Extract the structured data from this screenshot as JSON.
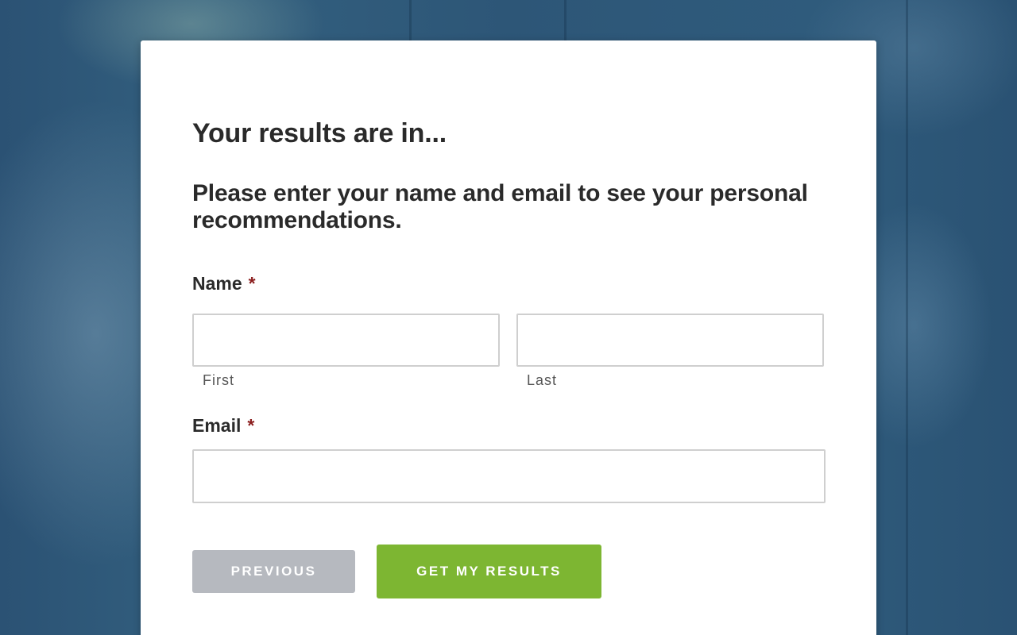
{
  "form": {
    "heading": "Your results are in...",
    "subheading": "Please enter your name and email to see your personal recommendations.",
    "name_field": {
      "label": "Name",
      "required_marker": "*",
      "first": {
        "value": "",
        "sublabel": "First"
      },
      "last": {
        "value": "",
        "sublabel": "Last"
      }
    },
    "email_field": {
      "label": "Email",
      "required_marker": "*",
      "value": ""
    },
    "buttons": {
      "previous_label": "PREVIOUS",
      "submit_label": "GET MY RESULTS"
    }
  },
  "colors": {
    "background": "#2f5878",
    "card": "#ffffff",
    "required_marker": "#8b1d1d",
    "previous_button": "#b6b9bf",
    "submit_button": "#7db632"
  }
}
